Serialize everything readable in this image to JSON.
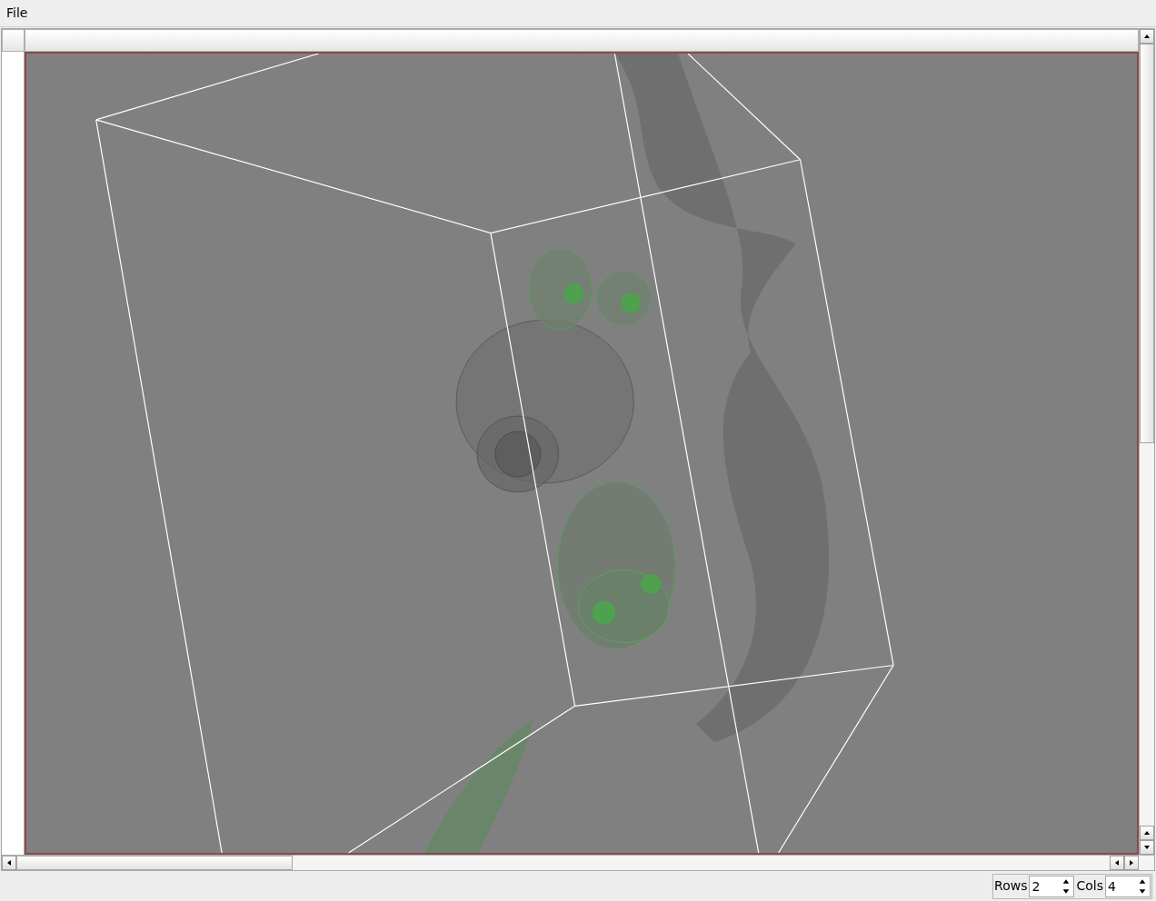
{
  "menu": [
    {
      "label": "File"
    }
  ],
  "grid_controls": [
    {
      "label": "Rows",
      "value": "2"
    },
    {
      "label": "Cols",
      "value": "4"
    }
  ]
}
